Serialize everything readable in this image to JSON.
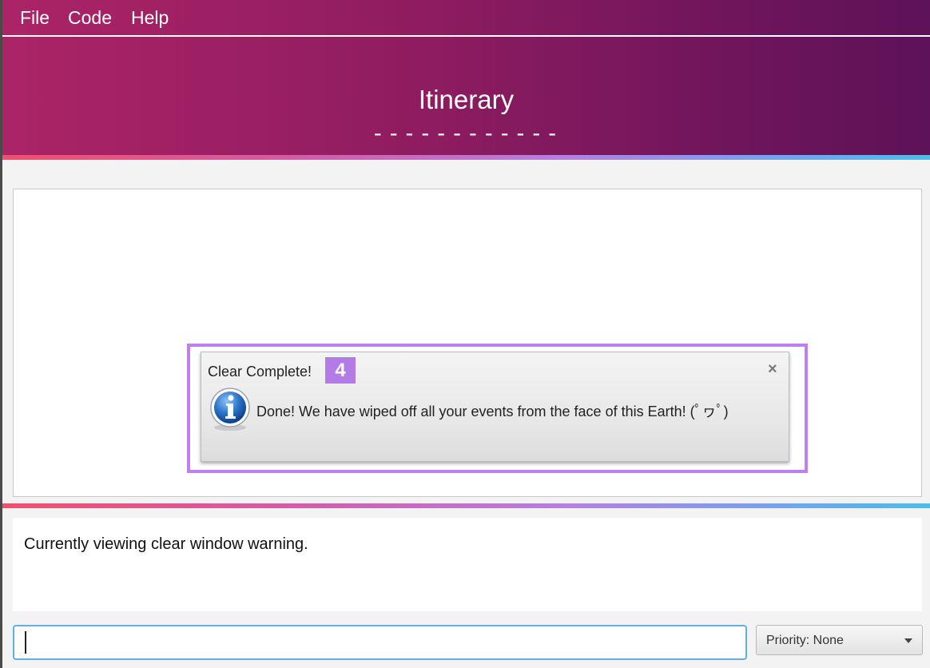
{
  "menu": {
    "items": [
      {
        "label": "File"
      },
      {
        "label": "Code"
      },
      {
        "label": "Help"
      }
    ]
  },
  "header": {
    "title": "Itinerary",
    "underline": "------------"
  },
  "notification": {
    "title": "Clear Complete!",
    "step_badge": "4",
    "message": "Done! We have wiped off all your events from the face of this Earth! (ﾟヮﾟ)",
    "close_glyph": "×",
    "icon": "info-icon"
  },
  "status": {
    "text": "Currently viewing clear window warning."
  },
  "command_input": {
    "value": "",
    "placeholder": ""
  },
  "priority": {
    "selected": "Priority: None"
  },
  "colors": {
    "header_start": "#ab2467",
    "header_end": "#5e1257",
    "accent_highlight": "#bf7ff0",
    "input_focus": "#5fb0e6"
  }
}
